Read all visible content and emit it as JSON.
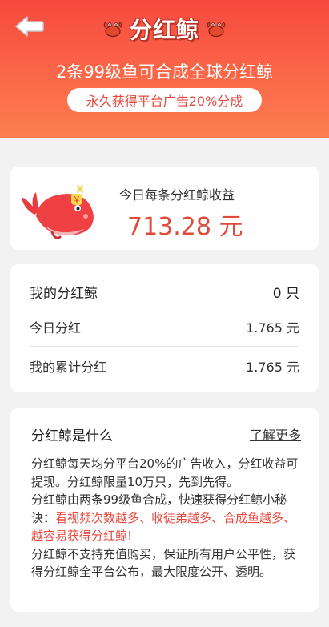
{
  "header": {
    "title": "分红鲸",
    "subtitle": "2条99级鱼可合成全球分红鲸",
    "pill": "永久获得平台广告20%分成"
  },
  "income_card": {
    "label": "今日每条分红鲸收益",
    "value": "713.28 元"
  },
  "stats_card": {
    "my_whales_label": "我的分红鲸",
    "my_whales_value": "0 只",
    "today_label": "今日分红",
    "today_value": "1.765 元",
    "total_label": "我的累计分红",
    "total_value": "1.765 元"
  },
  "info_card": {
    "title": "分红鲸是什么",
    "learn_more": "了解更多",
    "p1": "分红鲸每天均分平台20%的广告收入，分红收益可提现。分红鲸限量10万只，先到先得。",
    "p2_start": "分红鲸由两条99级鱼合成，快速获得分红鲸小秘诀：",
    "p2_red": "看视频次数越多、收徒弟越多、合成鱼越多、越容易获得分红鲸!",
    "p3": "分红鲸不支持充值购买，保证所有用户公平性，获得分红鲸全平台公布，最大限度公开、透明。"
  },
  "colors": {
    "header_top": "#f7493f",
    "header_bottom": "#fd7d52",
    "accent_red": "#e8473d",
    "background": "#f2f2f2"
  },
  "icons": [
    "back-arrow-icon",
    "crab-icon",
    "whale-icon"
  ]
}
